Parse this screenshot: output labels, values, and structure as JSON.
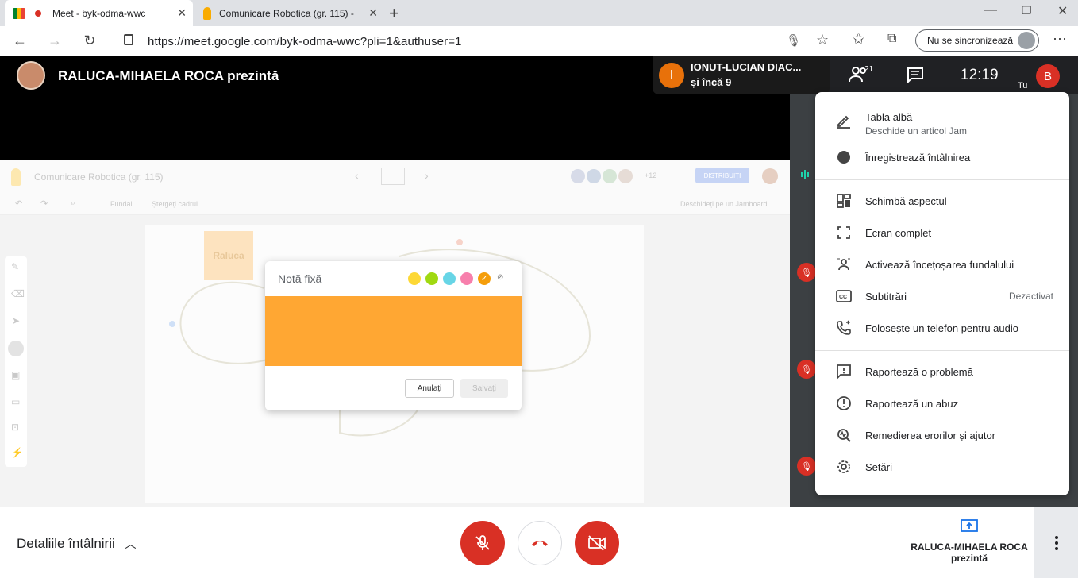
{
  "browser": {
    "tabs": [
      {
        "title": "Meet - byk-odma-wwc",
        "active": true
      },
      {
        "title": "Comunicare Robotica (gr. 115) -",
        "active": false
      }
    ],
    "url": "https://meet.google.com/byk-odma-wwc?pli=1&authuser=1",
    "sync_label": "Nu se sincronizează"
  },
  "meet": {
    "presenter_title": "RALUCA-MIHAELA ROCA prezintă",
    "speaker_name": "IONUT-LUCIAN DIAC...",
    "speaker_more": "și încă 9",
    "speaker_initial": "I",
    "participants_count": "21",
    "clock": "12:19",
    "self_initial": "B",
    "self_label": "Tu"
  },
  "jam": {
    "title": "Comunicare Robotica (gr. 115)",
    "share_label": "DISTRIBUIȚI",
    "more_count": "+12",
    "toolbar": {
      "background": "Fundal",
      "clear": "Ștergeți cadrul",
      "open": "Deschideți pe un Jamboard"
    },
    "sticky_text": "Raluca",
    "dialog": {
      "title": "Notă fixă",
      "cancel": "Anulați",
      "save": "Salvați"
    },
    "swatches": [
      "#fdd835",
      "#a0d911",
      "#67d5e6",
      "#f77fac",
      "#f59e0b"
    ]
  },
  "menu": {
    "items": [
      {
        "label": "Tabla albă",
        "sub": "Deschide un articol Jam",
        "icon": "pen-icon"
      },
      {
        "label": "Înregistrează întâlnirea",
        "icon": "record-icon"
      },
      {
        "label": "Schimbă aspectul",
        "icon": "layout-icon"
      },
      {
        "label": "Ecran complet",
        "icon": "fullscreen-icon"
      },
      {
        "label": "Activează încețoșarea fundalului",
        "icon": "blur-icon"
      },
      {
        "label": "Subtitrări",
        "right": "Dezactivat",
        "icon": "captions-icon"
      },
      {
        "label": "Folosește un telefon pentru audio",
        "icon": "phone-icon"
      },
      {
        "label": "Raportează o problemă",
        "icon": "feedback-icon"
      },
      {
        "label": "Raportează un abuz",
        "icon": "alert-icon"
      },
      {
        "label": "Remedierea erorilor și ajutor",
        "icon": "troubleshoot-icon"
      },
      {
        "label": "Setări",
        "icon": "gear-icon"
      }
    ]
  },
  "bottom": {
    "details": "Detaliile întâlnirii",
    "presenting_name": "RALUCA-MIHAELA ROCA",
    "presenting_label": "prezintă"
  },
  "colors": {
    "red": "#d93025",
    "orange": "#e8710a",
    "teal": "#1a73e8"
  }
}
